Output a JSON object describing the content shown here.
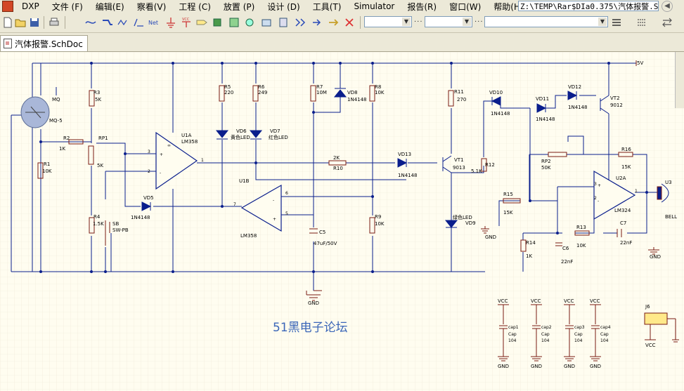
{
  "menu": {
    "items": [
      "DXP",
      "文件 (F)",
      "编辑(E)",
      "察看(V)",
      "工程 (C)",
      "放置 (P)",
      "设计 (D)",
      "工具(T)",
      "Simulator",
      "报告(R)",
      "窗口(W)",
      "帮助(H)"
    ],
    "path": "Z:\\TEMP\\Rar$DIa0.375\\汽体报警.S"
  },
  "toolbar": {
    "icons": [
      "new-file-icon",
      "open-folder-icon",
      "save-icon",
      "print-icon",
      "wire-icon",
      "bus-icon",
      "bus-entry-icon",
      "net-label-icon",
      "net-icon",
      "gnd-icon",
      "vcc-icon",
      "port-icon",
      "component-icon",
      "sheet-symbol-icon",
      "sheet-entry-icon",
      "directive-icon",
      "harness-icon",
      "junction-icon",
      "cross-icon"
    ]
  },
  "document": {
    "tab_label": "汽体报警.SchDoc"
  },
  "schematic": {
    "watermark": "51黑电子论坛",
    "supply_label": "5V",
    "gnd_label": "GND",
    "labels": {
      "mq": "MQ",
      "mq5": "MQ-5",
      "r1": "R1",
      "r1v": "10K",
      "r2": "R2",
      "r2v": "1K",
      "r3": "R3",
      "r3v": "5K",
      "rp1": "RP1",
      "rp1v": "5K",
      "r4": "R4",
      "r4v": "1.5K",
      "sb": "SB",
      "sbv": "SW-PB",
      "u1a": "U1A",
      "u1av": "LM358",
      "u1b": "U1B",
      "u1bv": "LM358",
      "vd5": "VD5",
      "vd5v": "1N4148",
      "r5": "R5",
      "r5v": "220",
      "r6": "R6",
      "r6v": "249",
      "vd6": "VD6",
      "vd6v": "黄色LED",
      "vd7": "VD7",
      "vd7v": "红色LED",
      "r7": "R7",
      "r7v": "10M",
      "vd8": "VD8",
      "vd8v": "1N4148",
      "c5": "C5",
      "c5v": "47uF/50V",
      "r8": "R8",
      "r8v": "10K",
      "r9": "R9",
      "r9v": "10K",
      "r10": "R10",
      "r10v": "2K",
      "vd13": "VD13",
      "vd13v": "1N4148",
      "vt1": "VT1",
      "vt1v": "9013",
      "r11": "R11",
      "r11v": "270",
      "r12": "R12",
      "r12v": "5.1K",
      "vd9": "VD9",
      "vd9v": "绿色LED",
      "vd10": "VD10",
      "vd10v": "1N4148",
      "vd11": "VD11",
      "vd11v": "1N4148",
      "vd12": "VD12",
      "vd12v": "1N4148",
      "vt2": "VT2",
      "vt2v": "9012",
      "rp2": "RP2",
      "rp2v": "50K",
      "r16": "R16",
      "r16v": "15K",
      "u2a": "U2A",
      "u2av": "LM324",
      "r15": "R15",
      "r15v": "15K",
      "r13": "R13",
      "r13v": "10K",
      "r14": "R14",
      "r14v": "1K",
      "c6": "C6",
      "c6v": "22nF",
      "c7": "C7",
      "c7v": "22nF",
      "u3": "U3",
      "bell": "BELL",
      "j6": "J6"
    },
    "pins": {
      "p3": "3",
      "p2": "2",
      "p1": "1",
      "p5": "5",
      "p6": "6",
      "p7": "7",
      "plus": "+",
      "minus": "-",
      "inf": "∞",
      "p4": "4",
      "p1b": "1",
      "p2b": "2",
      "p3b": "3"
    },
    "decoupling": [
      {
        "vcc": "VCC",
        "name": "cap1",
        "type": "Cap",
        "val": "104",
        "gnd": "GND"
      },
      {
        "vcc": "VCC",
        "name": "cap2",
        "type": "Cap",
        "val": "104",
        "gnd": "GND"
      },
      {
        "vcc": "VCC",
        "name": "cap3",
        "type": "Cap",
        "val": "104",
        "gnd": "GND"
      },
      {
        "vcc": "VCC",
        "name": "cap4",
        "type": "Cap",
        "val": "104",
        "gnd": "GND"
      }
    ],
    "j6_vcc": "VCC"
  }
}
